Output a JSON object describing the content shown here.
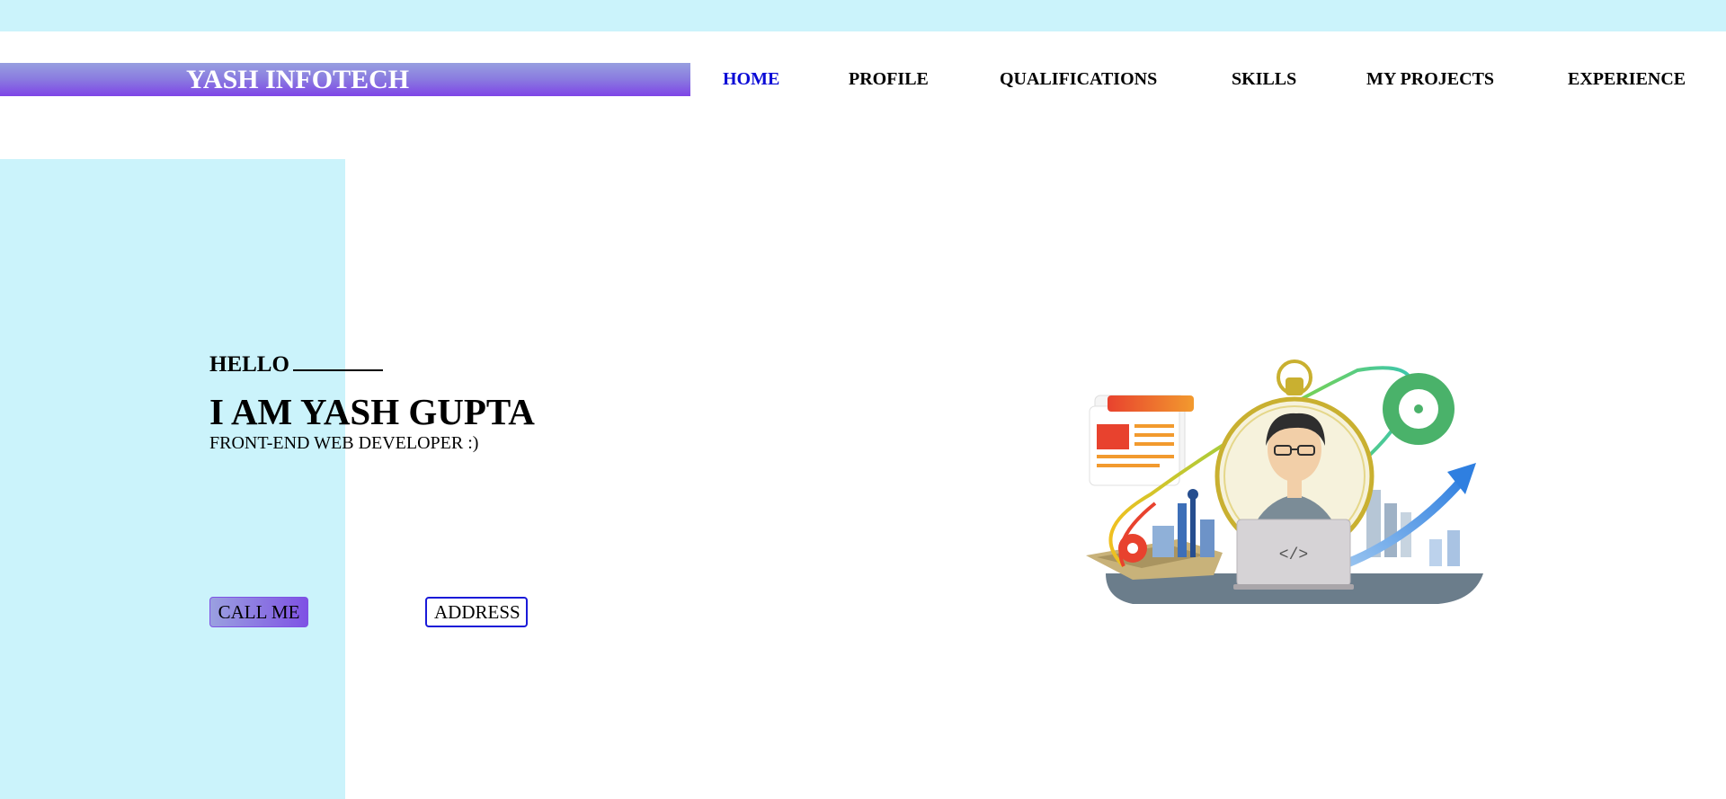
{
  "header": {
    "brand": "YASH INFOTECH",
    "nav": [
      {
        "label": "HOME",
        "active": true
      },
      {
        "label": "PROFILE"
      },
      {
        "label": "QUALIFICATIONS"
      },
      {
        "label": "SKILLS"
      },
      {
        "label": "MY PROJECTS"
      },
      {
        "label": "EXPERIENCE"
      }
    ]
  },
  "hero": {
    "greeting": "HELLO",
    "name": "I AM YASH GUPTA",
    "role": "FRONT-END WEB DEVELOPER :)",
    "buttons": {
      "call": "CALL ME",
      "address": "ADDRESS"
    },
    "laptop_code": "</>"
  },
  "colors": {
    "light_cyan": "#cbf3fb",
    "brand_gradient_start": "#979fe0",
    "brand_gradient_end": "#7e44e6",
    "active_link": "#0a0ad6"
  }
}
